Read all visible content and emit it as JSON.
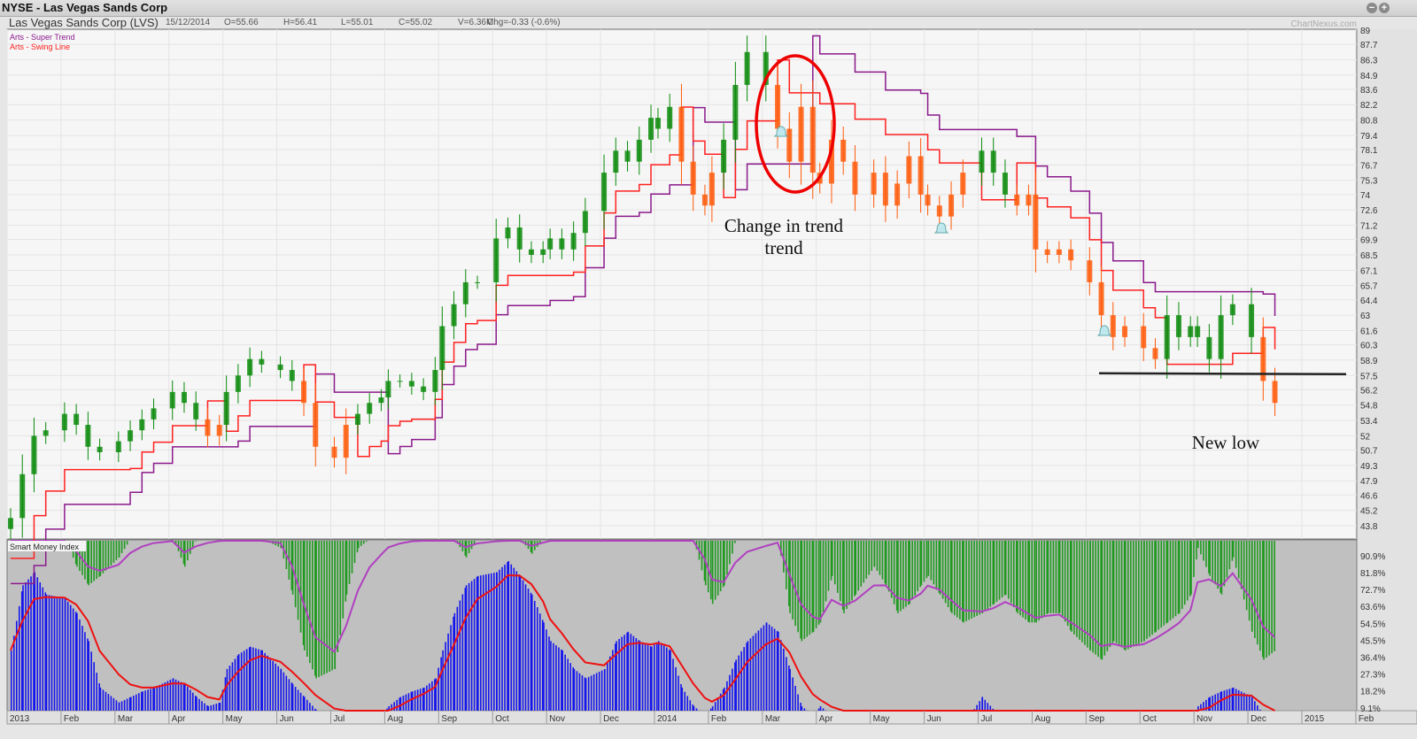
{
  "window": {
    "title": "NYSE - Las Vegas Sands Corp",
    "zoom_out_icon": "minus-circle-icon",
    "zoom_in_icon": "plus-circle-icon"
  },
  "info": {
    "name": "Las Vegas Sands Corp (LVS)",
    "date": "15/12/2014",
    "open": "O=55.66",
    "high": "H=56.41",
    "low": "L=55.01",
    "close": "C=55.02",
    "volume": "V=6.36M",
    "change": "Chg=-0.33 (-0.6%)"
  },
  "watermark": "ChartNexus.com",
  "legend": {
    "super_trend": "Arts - Super Trend",
    "swing_line": "Arts - Swing Line",
    "smi": "Smart Money Index"
  },
  "colors": {
    "up_candle": "#0a8a0a",
    "down_candle": "#ff5a0a",
    "super_trend": "#8b1a8b",
    "swing_line": "#ff2020",
    "smi_blue": "#1515ee",
    "smi_green": "#1f9a1f",
    "smi_red": "#ee1111",
    "smi_purple": "#b040c0",
    "pane_bg": "#f6f6f6",
    "smi_bg": "#c0c0c0"
  },
  "chart_data": {
    "type": "candlestick",
    "ylim": [
      43.8,
      89
    ],
    "price_ticks": [
      "89",
      "87.7",
      "86.3",
      "84.9",
      "83.6",
      "82.2",
      "80.8",
      "79.4",
      "78.1",
      "76.7",
      "75.3",
      "74",
      "72.6",
      "71.2",
      "69.9",
      "68.5",
      "67.1",
      "65.7",
      "64.4",
      "63",
      "61.6",
      "60.3",
      "58.9",
      "57.5",
      "56.2",
      "54.8",
      "53.4",
      "52",
      "50.7",
      "49.3",
      "47.9",
      "46.6",
      "45.2",
      "43.8"
    ],
    "smi_ticks": [
      "90.9%",
      "81.8%",
      "72.7%",
      "63.6%",
      "54.5%",
      "45.5%",
      "36.4%",
      "27.3%",
      "18.2%",
      "9.1%"
    ],
    "x_ticks": [
      "2013",
      "Feb",
      "Mar",
      "Apr",
      "May",
      "Jun",
      "Jul",
      "Aug",
      "Sep",
      "Oct",
      "Nov",
      "Dec",
      "2014",
      "Feb",
      "Mar",
      "Apr",
      "May",
      "Jun",
      "Jul",
      "Aug",
      "Sep",
      "Oct",
      "Nov",
      "Dec",
      "2015",
      "Feb"
    ],
    "months": [
      {
        "m": "2013-01",
        "close": [
          44.5,
          48.5,
          52,
          52.5
        ],
        "smi_blue": [
          40,
          75,
          82,
          70
        ],
        "smi_green": [
          100,
          100,
          100,
          100
        ]
      },
      {
        "m": "2013-02",
        "close": [
          54,
          53,
          51,
          50.5
        ],
        "smi_blue": [
          68,
          60,
          45,
          20
        ],
        "smi_green": [
          100,
          85,
          75,
          80
        ]
      },
      {
        "m": "2013-03",
        "close": [
          51.5,
          52.5,
          53.5,
          54.5
        ],
        "smi_blue": [
          12,
          15,
          18,
          20
        ],
        "smi_green": [
          90,
          100,
          100,
          100
        ]
      },
      {
        "m": "2013-04",
        "close": [
          56,
          55,
          53.5,
          52,
          53
        ],
        "smi_blue": [
          25,
          22,
          15,
          10,
          12
        ],
        "smi_green": [
          100,
          85,
          100,
          100,
          100
        ]
      },
      {
        "m": "2013-05",
        "close": [
          56,
          57.5,
          59,
          58.5
        ],
        "smi_blue": [
          30,
          38,
          42,
          40
        ],
        "smi_green": [
          100,
          100,
          100,
          100
        ]
      },
      {
        "m": "2013-06",
        "close": [
          58,
          57,
          55,
          51
        ],
        "smi_blue": [
          30,
          22,
          15,
          8
        ],
        "smi_green": [
          95,
          70,
          40,
          25
        ]
      },
      {
        "m": "2013-07",
        "close": [
          50,
          53,
          54,
          55,
          55.5
        ],
        "smi_blue": [
          0,
          0,
          0,
          2,
          5
        ],
        "smi_green": [
          30,
          70,
          95,
          100,
          100
        ]
      },
      {
        "m": "2013-08",
        "close": [
          57,
          57,
          56.5,
          56,
          58
        ],
        "smi_blue": [
          10,
          15,
          18,
          20,
          25
        ],
        "smi_green": [
          100,
          100,
          100,
          100,
          100
        ]
      },
      {
        "m": "2013-09",
        "close": [
          62,
          64,
          66,
          66
        ],
        "smi_blue": [
          40,
          60,
          75,
          80
        ],
        "smi_green": [
          100,
          100,
          90,
          100
        ]
      },
      {
        "m": "2013-10",
        "close": [
          70,
          71,
          69,
          68.5,
          69
        ],
        "smi_blue": [
          82,
          88,
          80,
          70,
          55
        ],
        "smi_green": [
          100,
          100,
          100,
          92,
          100
        ]
      },
      {
        "m": "2013-11",
        "close": [
          70,
          69,
          70.5,
          72.5
        ],
        "smi_blue": [
          45,
          40,
          30,
          25
        ],
        "smi_green": [
          100,
          100,
          100,
          100
        ]
      },
      {
        "m": "2013-12",
        "close": [
          76,
          78,
          77,
          79,
          81
        ],
        "smi_blue": [
          30,
          45,
          50,
          45,
          42
        ],
        "smi_green": [
          100,
          100,
          100,
          100,
          100
        ]
      },
      {
        "m": "2014-01",
        "close": [
          80,
          82,
          77,
          74,
          73
        ],
        "smi_blue": [
          45,
          40,
          20,
          10,
          5
        ],
        "smi_green": [
          100,
          100,
          100,
          100,
          75
        ]
      },
      {
        "m": "2014-02",
        "close": [
          76,
          79,
          84,
          87
        ],
        "smi_blue": [
          10,
          20,
          35,
          45
        ],
        "smi_green": [
          65,
          75,
          100,
          100
        ]
      },
      {
        "m": "2014-03",
        "close": [
          84,
          80,
          77,
          82,
          76
        ],
        "smi_blue": [
          55,
          50,
          30,
          10,
          5
        ],
        "smi_green": [
          100,
          100,
          60,
          45,
          50
        ]
      },
      {
        "m": "2014-04",
        "close": [
          75,
          79,
          77,
          74
        ],
        "smi_blue": [
          10,
          5,
          0,
          0
        ],
        "smi_green": [
          55,
          80,
          60,
          70
        ]
      },
      {
        "m": "2014-05",
        "close": [
          76,
          73,
          75,
          77.5,
          74
        ],
        "smi_blue": [
          0,
          0,
          0,
          0,
          0
        ],
        "smi_green": [
          85,
          75,
          60,
          65,
          75
        ]
      },
      {
        "m": "2014-06",
        "close": [
          73,
          72,
          74,
          76
        ],
        "smi_blue": [
          0,
          0,
          0,
          0
        ],
        "smi_green": [
          80,
          70,
          60,
          55
        ]
      },
      {
        "m": "2014-07",
        "close": [
          78,
          76,
          74,
          73,
          74
        ],
        "smi_blue": [
          15,
          8,
          0,
          0,
          0
        ],
        "smi_green": [
          60,
          65,
          70,
          60,
          55
        ]
      },
      {
        "m": "2014-08",
        "close": [
          69,
          68.5,
          69,
          68
        ],
        "smi_blue": [
          0,
          0,
          0,
          0
        ],
        "smi_green": [
          55,
          60,
          60,
          50
        ]
      },
      {
        "m": "2014-09",
        "close": [
          66,
          63,
          61,
          62
        ],
        "smi_blue": [
          0,
          0,
          0,
          0
        ],
        "smi_green": [
          40,
          35,
          45,
          40
        ]
      },
      {
        "m": "2014-10",
        "close": [
          60,
          59,
          63,
          61,
          62
        ],
        "smi_blue": [
          0,
          0,
          0,
          0,
          0
        ],
        "smi_green": [
          45,
          50,
          55,
          60,
          70
        ]
      },
      {
        "m": "2014-11",
        "close": [
          61,
          59,
          63,
          64
        ],
        "smi_blue": [
          10,
          15,
          18,
          20
        ],
        "smi_green": [
          95,
          80,
          70,
          90
        ]
      },
      {
        "m": "2014-12",
        "close": [
          61,
          57,
          55
        ],
        "smi_blue": [
          15,
          5,
          0
        ],
        "smi_green": [
          50,
          35,
          40
        ]
      }
    ],
    "annotations": {
      "trend_change": "Change in trend",
      "new_low": "New low",
      "support_level": 57.7
    }
  }
}
